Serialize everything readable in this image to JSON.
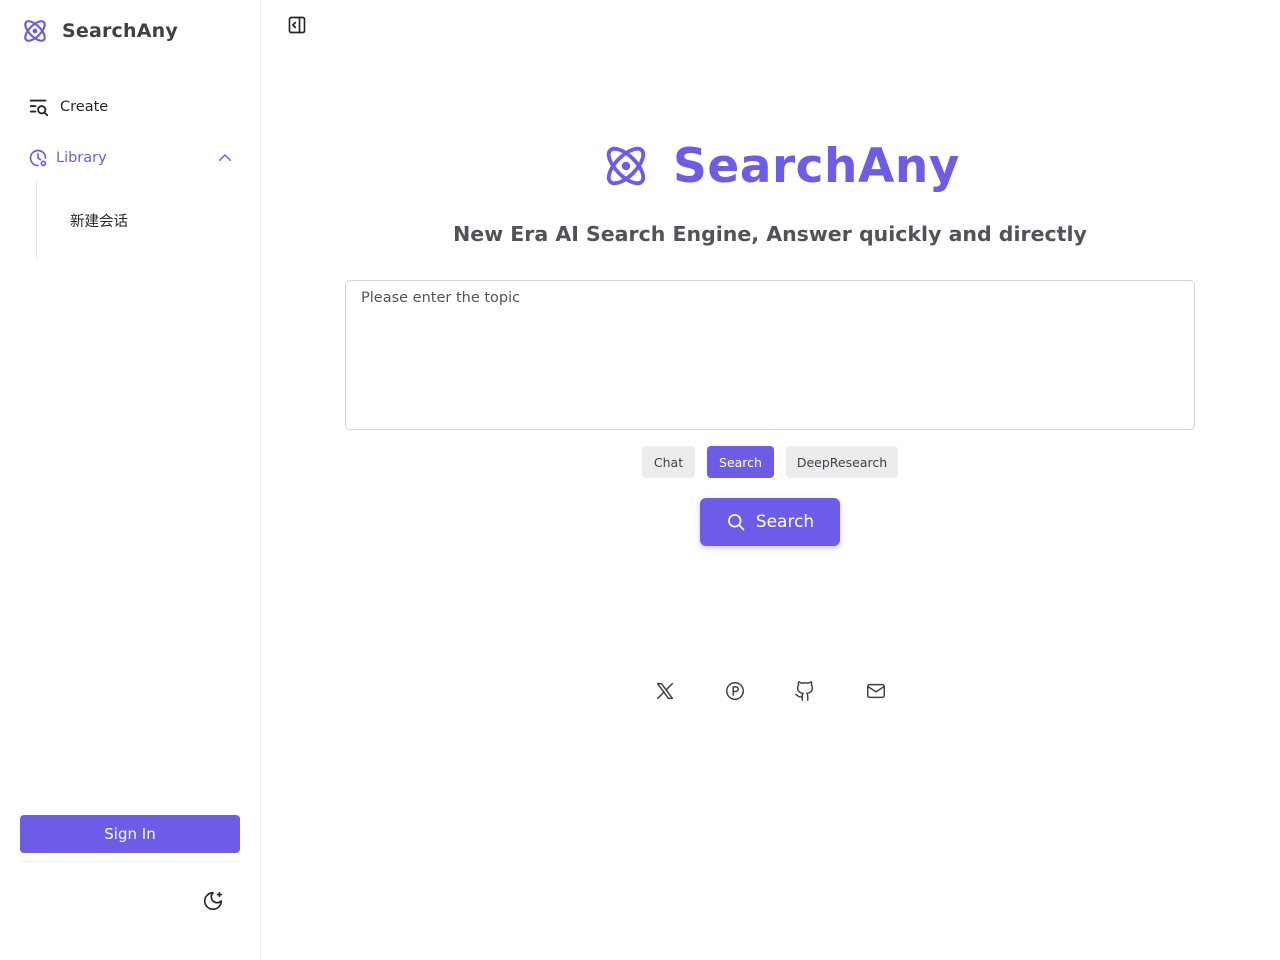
{
  "app": {
    "name": "SearchAny",
    "accent_color": "#6c5ce7",
    "logo_icon": "atom-icon"
  },
  "sidebar": {
    "create_label": "Create",
    "create_icon": "search-list-icon",
    "library_label": "Library",
    "library_icon": "history-icon",
    "library_expanded": true,
    "library_items": [
      {
        "label": "新建会话"
      }
    ],
    "signin_label": "Sign In",
    "theme_icon": "moon-icon"
  },
  "main": {
    "collapse_icon": "panel-collapse-icon",
    "hero_title": "SearchAny",
    "subtitle": "New Era AI Search Engine, Answer quickly and directly",
    "input_placeholder": "Please enter the topic",
    "input_value": "",
    "modes": [
      {
        "label": "Chat",
        "active": false
      },
      {
        "label": "Search",
        "active": true
      },
      {
        "label": "DeepResearch",
        "active": false
      }
    ],
    "search_button_label": "Search",
    "social_icons": [
      "x-icon",
      "producthunt-icon",
      "github-icon",
      "mail-icon"
    ]
  }
}
